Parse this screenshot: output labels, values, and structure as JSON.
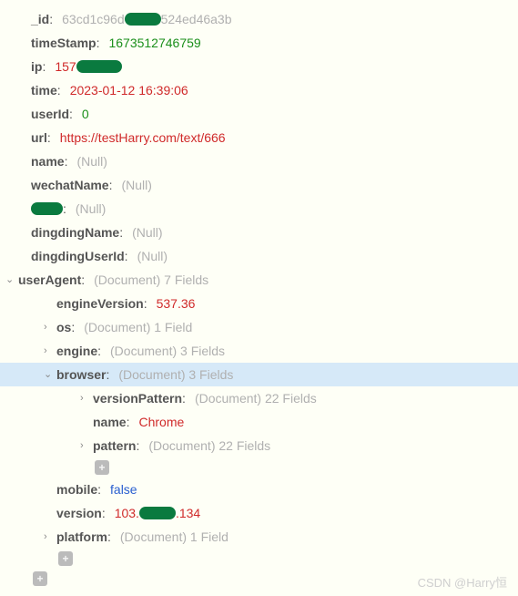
{
  "fields": {
    "id": {
      "key": "_id",
      "prefix": "63cd1c96d",
      "suffix": "524ed46a3b"
    },
    "timeStamp": {
      "key": "timeStamp",
      "value": "1673512746759"
    },
    "ip": {
      "key": "ip",
      "prefix": "157"
    },
    "time": {
      "key": "time",
      "value": "2023-01-12 16:39:06"
    },
    "userId": {
      "key": "userId",
      "value": "0"
    },
    "url": {
      "key": "url",
      "value": "https://testHarry.com/text/666"
    },
    "name": {
      "key": "name",
      "value": "(Null)"
    },
    "wechatName": {
      "key": "wechatName",
      "value": "(Null)"
    },
    "hiddenField": {
      "value": "(Null)"
    },
    "dingdingName": {
      "key": "dingdingName",
      "value": "(Null)"
    },
    "dingdingUserId": {
      "key": "dingdingUserId",
      "value": "(Null)"
    },
    "userAgent": {
      "key": "userAgent",
      "meta": "(Document) 7 Fields"
    },
    "engineVersion": {
      "key": "engineVersion",
      "value": "537.36"
    },
    "os": {
      "key": "os",
      "meta": "(Document) 1 Field"
    },
    "engine": {
      "key": "engine",
      "meta": "(Document) 3 Fields"
    },
    "browser": {
      "key": "browser",
      "meta": "(Document) 3 Fields"
    },
    "versionPattern": {
      "key": "versionPattern",
      "meta": "(Document) 22 Fields"
    },
    "browserName": {
      "key": "name",
      "value": "Chrome"
    },
    "pattern": {
      "key": "pattern",
      "meta": "(Document) 22 Fields"
    },
    "mobile": {
      "key": "mobile",
      "value": "false"
    },
    "version": {
      "key": "version",
      "prefix": "103.",
      "suffix": ".134"
    },
    "platform": {
      "key": "platform",
      "meta": "(Document) 1 Field"
    }
  },
  "colon": " :",
  "watermark": "CSDN @Harry恒",
  "plus": "+"
}
